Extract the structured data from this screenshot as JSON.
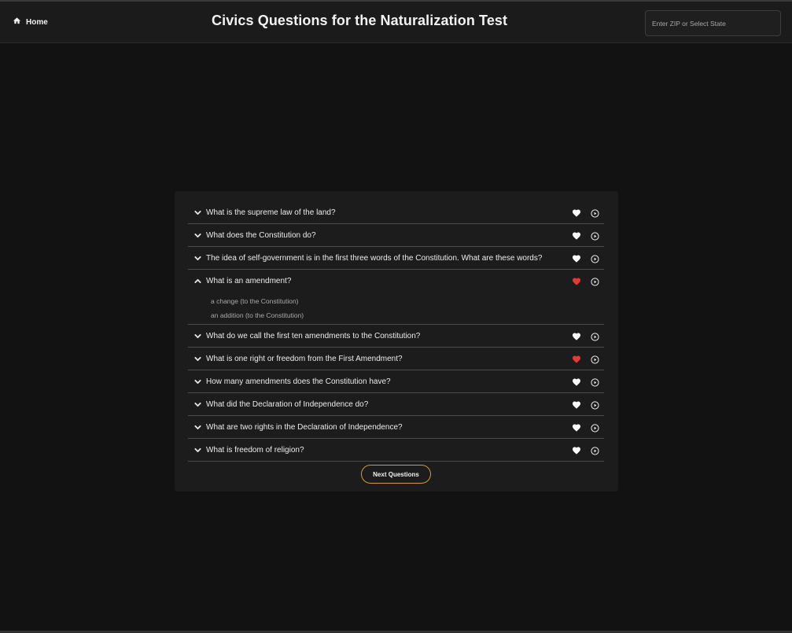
{
  "header": {
    "home_label": "Home",
    "title": "Civics Questions for the Naturalization Test",
    "zip_placeholder": "Enter ZIP or Select State",
    "zip_value": ""
  },
  "questions": [
    {
      "text": "What is the supreme law of the land?",
      "expanded": false,
      "favorited": false,
      "answers": []
    },
    {
      "text": "What does the Constitution do?",
      "expanded": false,
      "favorited": false,
      "answers": []
    },
    {
      "text": "The idea of self-government is in the first three words of the Constitution. What are these words?",
      "expanded": false,
      "favorited": false,
      "answers": []
    },
    {
      "text": "What is an amendment?",
      "expanded": true,
      "favorited": true,
      "answers": [
        "a change (to the Constitution)",
        "an addition (to the Constitution)"
      ]
    },
    {
      "text": "What do we call the first ten amendments to the Constitution?",
      "expanded": false,
      "favorited": false,
      "answers": []
    },
    {
      "text": "What is one right or freedom from the First Amendment?",
      "expanded": false,
      "favorited": true,
      "answers": []
    },
    {
      "text": "How many amendments does the Constitution have?",
      "expanded": false,
      "favorited": false,
      "answers": []
    },
    {
      "text": "What did the Declaration of Independence do?",
      "expanded": false,
      "favorited": false,
      "answers": []
    },
    {
      "text": "What are two rights in the Declaration of Independence?",
      "expanded": false,
      "favorited": false,
      "answers": []
    },
    {
      "text": "What is freedom of religion?",
      "expanded": false,
      "favorited": false,
      "answers": []
    }
  ],
  "next_button_label": "Next Questions",
  "colors": {
    "background": "#121212",
    "panel": "#1c1c1c",
    "accent_border": "#d9963a",
    "favorite_active": "#e53935",
    "favorite_inactive": "#ffffff"
  },
  "icons": {
    "home": "home-icon",
    "expand": "chevron-down-icon",
    "collapse": "chevron-up-icon",
    "favorite": "heart-icon",
    "play": "play-circle-icon"
  }
}
